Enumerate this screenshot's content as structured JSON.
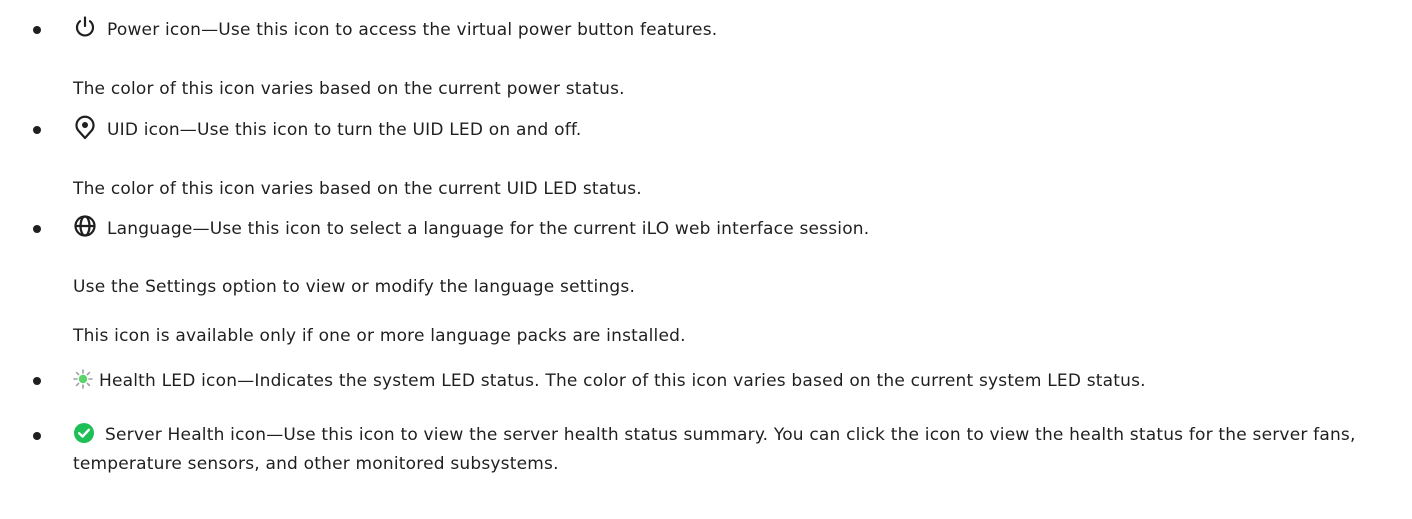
{
  "items": [
    {
      "icon": "power-icon",
      "title": "Power icon",
      "desc": "—Use this icon to access the virtual power button features.",
      "notes": [
        "The color of this icon varies based on the current power status."
      ]
    },
    {
      "icon": "uid-icon",
      "title": "UID icon",
      "desc": "—Use this icon to turn the UID LED on and off.",
      "notes": [
        "The color of this icon varies based on the current UID LED status."
      ]
    },
    {
      "icon": "globe-icon",
      "title": "Language",
      "desc": "—Use this icon to select a language for the current  iLO web interface session.",
      "notes": [
        "Use the Settings option to view or modify the language settings.",
        "This icon is available only if one or more language packs are installed."
      ]
    },
    {
      "icon": "health-led-icon",
      "title": "Health LED icon",
      "desc": "—Indicates the system LED status. The color of this icon varies based on the current system LED status.",
      "notes": []
    },
    {
      "icon": "server-health-check-icon",
      "title": "Server Health icon",
      "desc": "—Use this icon to view the server health status summary. You can click the icon to view the health status for the server fans, temperature sensors, and other monitored subsystems.",
      "notes": []
    }
  ],
  "colors": {
    "text": "#1f1f1f",
    "health_led": "#5ad36a",
    "server_health": "#1fbf57"
  }
}
